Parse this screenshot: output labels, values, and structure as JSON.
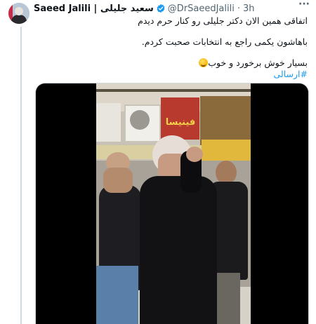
{
  "tweet": {
    "author_name": "Saeed Jalili | سعید جلیلی",
    "handle": "@DrSaeedJalili",
    "separator": "·",
    "time": "3h",
    "more": "···",
    "lines": [
      "اتفاقی همین الان دکتر جلیلی رو کنار حرم دیدم",
      "باهاشون یکمی راجع به انتخابات صحبت کردم.",
      "بسیار خوش برخورد و خوب"
    ],
    "hashtag": "#ارسالی"
  },
  "media": {
    "shop_sign": "فینیسا"
  },
  "colors": {
    "link": "#1d9bf0",
    "verified": "#1d9bf0",
    "meta": "#536471"
  },
  "icons": [
    "verified-badge-icon",
    "more-options-icon",
    "smiling-face-emoji"
  ]
}
